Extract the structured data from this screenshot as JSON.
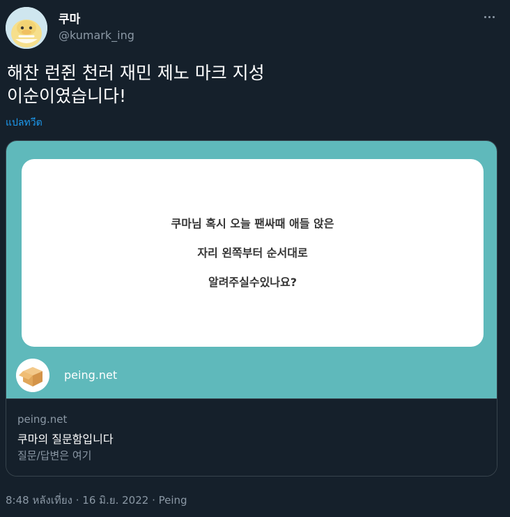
{
  "colors": {
    "background": "#15202b",
    "link": "#1d9bf0",
    "card_image_bg": "#5fb9bb",
    "secondary_text": "#8b98a5",
    "border": "#38444d"
  },
  "author": {
    "display_name": "쿠마",
    "handle": "@kumark_ing",
    "avatar_icon": "duck-avatar-icon"
  },
  "menu": {
    "icon": "more-options-icon"
  },
  "tweet": {
    "text_lines": [
      "해찬 런쥔 천러 재민 제노 마크 지성",
      "이순이였습니다!"
    ],
    "translate_label": "แปลทวีต"
  },
  "card": {
    "question_lines": [
      "쿠마님 혹시 오늘 팬싸때 애들 앉은",
      "자리 왼쪽부터 순서대로",
      "알려주실수있나요?"
    ],
    "site_logo_icon": "box-logo-icon",
    "site_name": "peing.net",
    "domain": "peing.net",
    "title": "쿠마의 질문함입니다",
    "description": "질문/답변은 여기"
  },
  "meta": {
    "time": "8:48 หลังเที่ยง",
    "separator": " · ",
    "date": "16 มิ.ย. 2022",
    "source": "Peing"
  }
}
